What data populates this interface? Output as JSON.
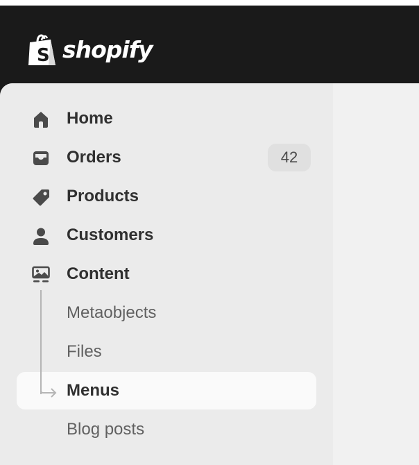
{
  "brand": {
    "name": "shopify",
    "logo_icon": "shopping-bag-icon",
    "header_color": "#1a1a1a"
  },
  "sidebar": {
    "items": [
      {
        "label": "Home",
        "icon": "home-icon"
      },
      {
        "label": "Orders",
        "icon": "inbox-icon",
        "badge": "42"
      },
      {
        "label": "Products",
        "icon": "tag-icon"
      },
      {
        "label": "Customers",
        "icon": "person-icon"
      },
      {
        "label": "Content",
        "icon": "image-icon"
      }
    ],
    "content_subitems": [
      {
        "label": "Metaobjects"
      },
      {
        "label": "Files"
      },
      {
        "label": "Menus",
        "active": true
      },
      {
        "label": "Blog posts"
      }
    ],
    "active_background": "#fafafa",
    "sidebar_background": "#ebebeb"
  }
}
